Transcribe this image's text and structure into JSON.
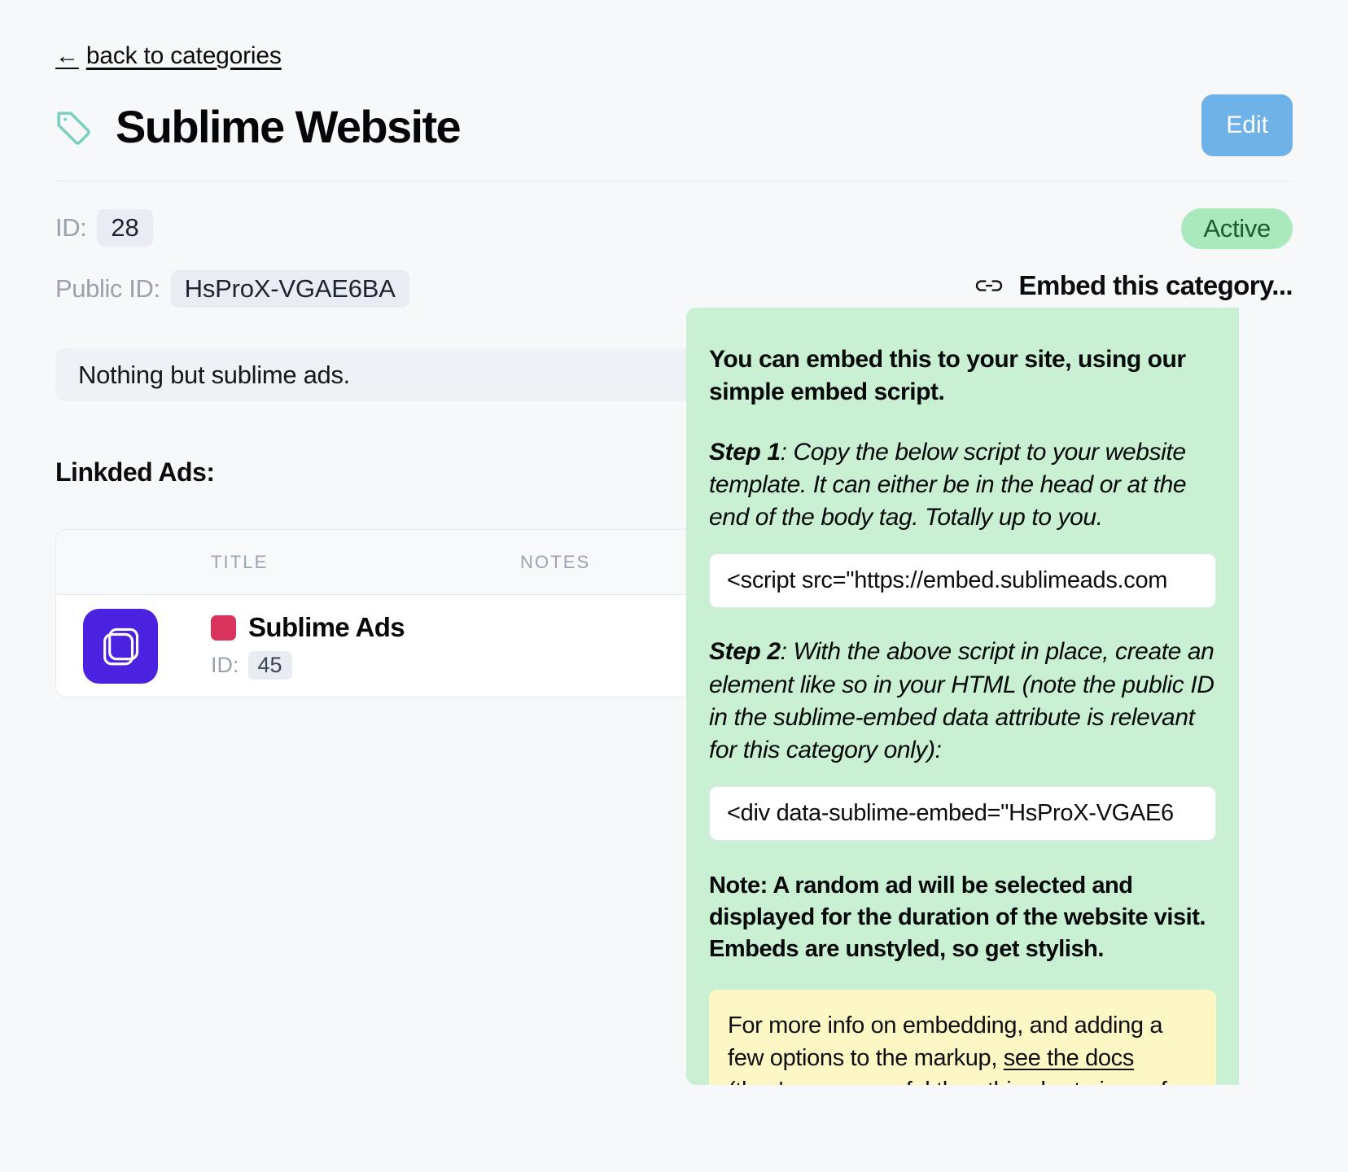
{
  "back_link": {
    "arrow": "←",
    "label": "back to categories"
  },
  "header": {
    "tag_icon": "tag-icon",
    "title": "Sublime Website",
    "edit_label": "Edit"
  },
  "meta": {
    "id_label": "ID:",
    "id_value": "28",
    "public_id_label": "Public ID:",
    "public_id_value": "HsProX-VGAE6BA",
    "status": "Active"
  },
  "embed_toggle": {
    "icon": "link-icon",
    "label": "Embed this category..."
  },
  "description": "Nothing but sublime ads.",
  "linked_ads": {
    "heading": "Linkded Ads:",
    "columns": [
      "TITLE",
      "NOTES"
    ],
    "rows": [
      {
        "thumb_icon": "ad-thumbnail-icon",
        "swatch_color": "#d9325c",
        "title": "Sublime Ads",
        "id_label": "ID:",
        "id_value": "45",
        "notes": ""
      }
    ]
  },
  "embed_popover": {
    "intro": "You can embed this to your site, using our simple embed script.",
    "step1_label": "Step 1",
    "step1_text": ": Copy the below script to your website template. It can either be in the head or at the end of the body tag. Totally up to you.",
    "script_code": "<script src=\"https://embed.sublimeads.com",
    "step2_label": "Step 2",
    "step2_text": ": With the above script in place, create an element like so in your HTML (note the public ID in the sublime-embed data attribute is relevant for this category only):",
    "div_code": "<div data-sublime-embed=\"HsProX-VGAE6",
    "note": "Note: A random ad will be selected and displayed for the duration of the website visit. Embeds are unstyled, so get stylish.",
    "docs_before": "For more info on embedding, and adding a few options to the markup, ",
    "docs_link": "see the docs",
    "docs_after": " (they're more useful than this short piece of text)."
  },
  "colors": {
    "accent_blue": "#6fb2e8",
    "status_green_bg": "#a9e9bb",
    "status_green_fg": "#1d5b33",
    "popover_green": "#c9f0d3",
    "docs_yellow": "#fcf7c5",
    "tag_teal": "#7ed0c1",
    "thumb_purple": "#4a22e0",
    "swatch_crimson": "#d9325c"
  }
}
